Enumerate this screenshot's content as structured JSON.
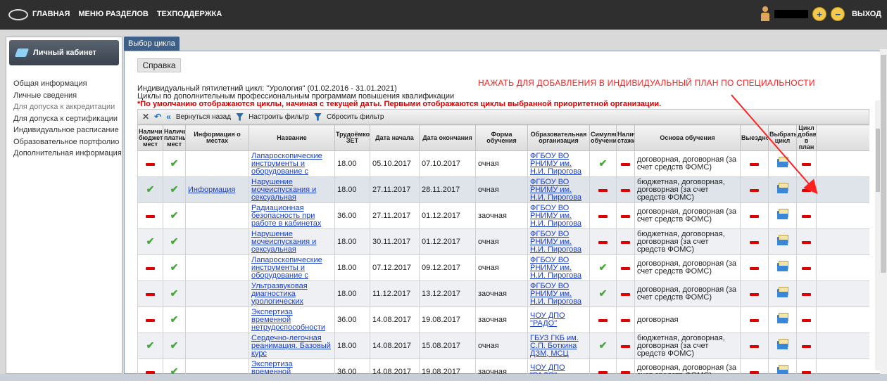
{
  "topbar": {
    "nav": [
      "ГЛАВНАЯ",
      "МЕНЮ РАЗДЕЛОВ",
      "ТЕХПОДДЕРЖКА"
    ],
    "exit_label": "ВЫХОД"
  },
  "sidebar": {
    "title": "Личный кабинет",
    "items": [
      {
        "label": "Общая информация"
      },
      {
        "label": "Личные сведения"
      },
      {
        "label": "Для допуска к аккредитации"
      },
      {
        "label": "Для допуска к сертификации"
      },
      {
        "label": "Индивидуальное расписание"
      },
      {
        "label": "Образовательное портфолио"
      },
      {
        "label": "Дополнительная информация"
      }
    ]
  },
  "main": {
    "tab": "Выбор цикла",
    "help_button": "Справка",
    "annotation": "НАЖАТЬ ДЛЯ ДОБАВЛЕНИЯ В ИНДИВИДУАЛЬНЫЙ ПЛАН ПО СПЕЦИАЛЬНОСТИ",
    "info": {
      "line1": "Индивидуальный пятилетний цикл: \"Урология\" (01.02.2016 - 31.01.2021)",
      "line2": "Циклы по дополнительным профессиональным программам повышения квалификации",
      "warning": "*По умолчанию отображаются циклы, начиная с текущей даты. Первыми отображаются циклы выбранной приоритетной организации."
    },
    "toolbar": {
      "back": "Вернуться назад",
      "filter": "Настроить фильтр",
      "reset": "Сбросить фильтр"
    }
  },
  "table": {
    "headers": {
      "budget": "Наличие бюджетных мест",
      "paid": "Наличие платных мест",
      "info": "Информация о местах",
      "name": "Название",
      "zet": "Трудоёмкость ЗЕТ",
      "start": "Дата начала",
      "end": "Дата окончания",
      "form": "Форма обучения",
      "org": "Образовательная организация",
      "sim": "Симуляционное обучение",
      "intern": "Наличие стажировки",
      "basis": "Основа обучения",
      "dayoff": "Выездное",
      "choose": "Выбрать цикл",
      "added": "Цикл добавлен в план"
    },
    "rows": [
      {
        "budget": false,
        "paid": true,
        "info": "",
        "name": "Лапароскопические инструменты и оборудование с",
        "zet": "18.00",
        "start": "05.10.2017",
        "end": "07.10.2017",
        "form": "очная",
        "org": "ФГБОУ ВО РНИМУ им. Н.И. Пирогова",
        "sim": true,
        "intern": false,
        "basis": "договорная, договорная (за счет средств ФОМС)",
        "dayoff": false,
        "added": false
      },
      {
        "budget": true,
        "paid": true,
        "info": "Информация",
        "name": "Нарушение мочеиспускания и сексуальная",
        "zet": "18.00",
        "start": "27.11.2017",
        "end": "28.11.2017",
        "form": "очная",
        "org": "ФГБОУ ВО РНИМУ им. Н.И. Пирогова",
        "sim": false,
        "intern": false,
        "basis": "бюджетная, договорная, договорная (за счет средств ФОМС)",
        "dayoff": false,
        "added": false
      },
      {
        "budget": false,
        "paid": true,
        "info": "",
        "name": "Радиационная безопасность при работе в кабинетах",
        "zet": "36.00",
        "start": "27.11.2017",
        "end": "01.12.2017",
        "form": "заочная",
        "org": "ФГБОУ ВО РНИМУ им. Н.И. Пирогова",
        "sim": false,
        "intern": false,
        "basis": "договорная, договорная (за счет средств ФОМС)",
        "dayoff": false,
        "added": false
      },
      {
        "budget": true,
        "paid": true,
        "info": "",
        "name": "Нарушение мочеиспускания и сексуальная",
        "zet": "18.00",
        "start": "30.11.2017",
        "end": "01.12.2017",
        "form": "очная",
        "org": "ФГБОУ ВО РНИМУ им. Н.И. Пирогова",
        "sim": false,
        "intern": false,
        "basis": "бюджетная, договорная, договорная (за счет средств ФОМС)",
        "dayoff": false,
        "added": false
      },
      {
        "budget": false,
        "paid": true,
        "info": "",
        "name": "Лапароскопические инструменты и оборудование с",
        "zet": "18.00",
        "start": "07.12.2017",
        "end": "09.12.2017",
        "form": "очная",
        "org": "ФГБОУ ВО РНИМУ им. Н.И. Пирогова",
        "sim": true,
        "intern": false,
        "basis": "договорная, договорная (за счет средств ФОМС)",
        "dayoff": false,
        "added": false
      },
      {
        "budget": false,
        "paid": true,
        "info": "",
        "name": "Ультразвуковая диагностика урологических",
        "zet": "18.00",
        "start": "11.12.2017",
        "end": "13.12.2017",
        "form": "заочная",
        "org": "ФГБОУ ВО РНИМУ им. Н.И. Пирогова",
        "sim": true,
        "intern": false,
        "basis": "договорная, договорная (за счет средств ФОМС)",
        "dayoff": false,
        "added": false
      },
      {
        "budget": false,
        "paid": true,
        "info": "",
        "name": "Экспертиза временной нетрудоспособности",
        "zet": "36.00",
        "start": "14.08.2017",
        "end": "19.08.2017",
        "form": "заочная",
        "org": "ЧОУ ДПО \"РАДО\"",
        "sim": false,
        "intern": false,
        "basis": "договорная",
        "dayoff": false,
        "added": false
      },
      {
        "budget": true,
        "paid": true,
        "info": "",
        "name": "Сердечно-легочная реанимация. Базовый курс",
        "zet": "18.00",
        "start": "14.08.2017",
        "end": "15.08.2017",
        "form": "очная",
        "org": "ГБУЗ ГКБ им. С.П. Боткина ДЗМ, МСЦ",
        "sim": true,
        "intern": false,
        "basis": "бюджетная, договорная, договорная (за счет средств ФОМС)",
        "dayoff": false,
        "added": false
      },
      {
        "budget": false,
        "paid": true,
        "info": "",
        "name": "Экспертиза временной нетрудоспособности",
        "zet": "36.00",
        "start": "14.08.2017",
        "end": "19.08.2017",
        "form": "заочная",
        "org": "ЧОУ ДПО \"РАДО\"",
        "sim": false,
        "intern": false,
        "basis": "договорная, договорная (за счет средств ФОМС)",
        "dayoff": false,
        "added": false
      }
    ]
  },
  "colors": {
    "accent": "#3d5f88",
    "warning": "#d60000",
    "link": "#1a3fc9",
    "check": "#47a83a"
  }
}
